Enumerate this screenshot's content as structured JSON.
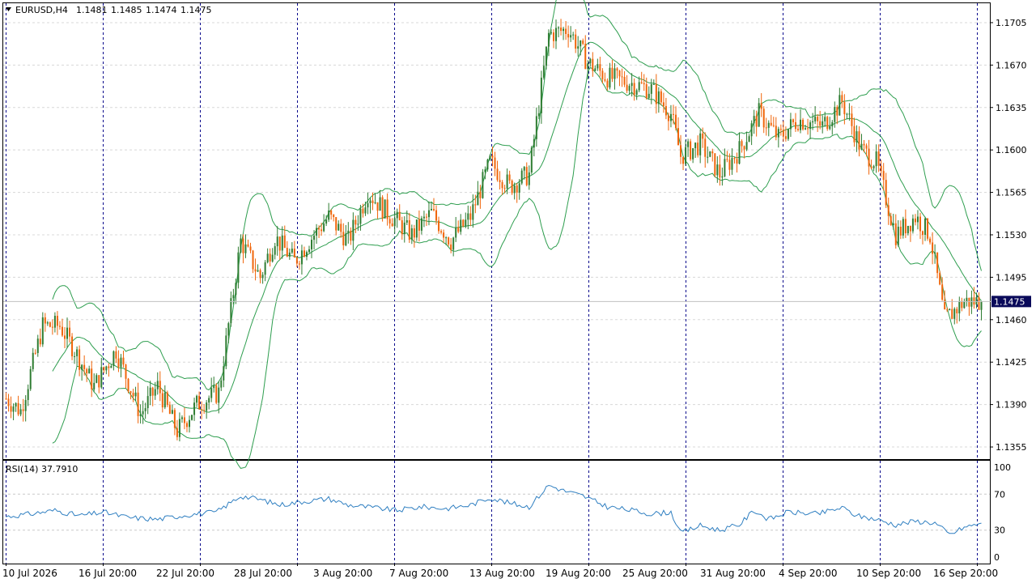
{
  "header": {
    "symbol": "EURUSD,H4",
    "open": "1.1481",
    "high": "1.1485",
    "low": "1.1474",
    "close": "1.1475"
  },
  "price_axis": {
    "ticks": [
      "1.1705",
      "1.1670",
      "1.1635",
      "1.1600",
      "1.1565",
      "1.1530",
      "1.1495",
      "1.1460",
      "1.1425",
      "1.1390",
      "1.1355"
    ],
    "current_price_label": "1.1475"
  },
  "rsi_panel": {
    "label": "RSI(14) 37.7910",
    "ticks": [
      "100",
      "70",
      "30",
      "0"
    ]
  },
  "time_axis": {
    "labels": [
      "10 Jul 2026",
      "16 Jul 20:00",
      "22 Jul 20:00",
      "28 Jul 20:00",
      "3 Aug 20:00",
      "7 Aug 20:00",
      "13 Aug 20:00",
      "19 Aug 20:00",
      "25 Aug 20:00",
      "31 Aug 20:00",
      "4 Sep 20:00",
      "10 Sep 20:00",
      "16 Sep 20:00"
    ]
  },
  "colors": {
    "bull": "#2f7d32",
    "bear": "#f0650a",
    "band": "#2e9e4f",
    "rsi_line": "#2f7fc1",
    "separator": "#00008b",
    "price_tag_bg": "#0a0a5a"
  },
  "chart_data": [
    {
      "type": "candlestick",
      "title": "EURUSD,H4",
      "ylim": [
        1.1345,
        1.1721
      ],
      "current_price": 1.1475,
      "indicators": [
        "Bollinger Bands"
      ],
      "grid": true,
      "anchors": [
        [
          0,
          1.1395
        ],
        [
          6,
          1.1385
        ],
        [
          15,
          1.1455
        ],
        [
          22,
          1.1455
        ],
        [
          28,
          1.1435
        ],
        [
          36,
          1.1405
        ],
        [
          45,
          1.1435
        ],
        [
          55,
          1.1382
        ],
        [
          62,
          1.1405
        ],
        [
          70,
          1.1368
        ],
        [
          78,
          1.139
        ],
        [
          87,
          1.14
        ],
        [
          96,
          1.1525
        ],
        [
          104,
          1.1495
        ],
        [
          110,
          1.1528
        ],
        [
          118,
          1.1508
        ],
        [
          124,
          1.1525
        ],
        [
          132,
          1.1545
        ],
        [
          140,
          1.1525
        ],
        [
          148,
          1.1565
        ],
        [
          156,
          1.1548
        ],
        [
          166,
          1.153
        ],
        [
          174,
          1.1548
        ],
        [
          182,
          1.1525
        ],
        [
          190,
          1.1545
        ],
        [
          198,
          1.159
        ],
        [
          206,
          1.157
        ],
        [
          214,
          1.158
        ],
        [
          222,
          1.1695
        ],
        [
          230,
          1.17
        ],
        [
          238,
          1.1672
        ],
        [
          246,
          1.166
        ],
        [
          256,
          1.1655
        ],
        [
          264,
          1.165
        ],
        [
          272,
          1.163
        ],
        [
          276,
          1.1595
        ],
        [
          284,
          1.1605
        ],
        [
          292,
          1.158
        ],
        [
          300,
          1.16
        ],
        [
          308,
          1.163
        ],
        [
          316,
          1.161
        ],
        [
          324,
          1.1625
        ],
        [
          334,
          1.162
        ],
        [
          342,
          1.164
        ],
        [
          350,
          1.16
        ],
        [
          356,
          1.159
        ],
        [
          364,
          1.153
        ],
        [
          372,
          1.1545
        ],
        [
          378,
          1.153
        ],
        [
          384,
          1.146
        ],
        [
          392,
          1.1475
        ],
        [
          399,
          1.1475
        ]
      ]
    },
    {
      "type": "line",
      "title": "RSI(14) 37.7910",
      "ylim": [
        0,
        100
      ],
      "levels": [
        30,
        70
      ],
      "anchors": [
        [
          0,
          45
        ],
        [
          10,
          48
        ],
        [
          20,
          52
        ],
        [
          30,
          46
        ],
        [
          40,
          50
        ],
        [
          50,
          44
        ],
        [
          62,
          42
        ],
        [
          74,
          47
        ],
        [
          86,
          50
        ],
        [
          96,
          68
        ],
        [
          104,
          64
        ],
        [
          112,
          58
        ],
        [
          122,
          62
        ],
        [
          132,
          65
        ],
        [
          140,
          58
        ],
        [
          150,
          55
        ],
        [
          160,
          52
        ],
        [
          170,
          56
        ],
        [
          180,
          54
        ],
        [
          190,
          58
        ],
        [
          198,
          66
        ],
        [
          206,
          60
        ],
        [
          214,
          56
        ],
        [
          222,
          80
        ],
        [
          228,
          74
        ],
        [
          236,
          68
        ],
        [
          246,
          56
        ],
        [
          256,
          52
        ],
        [
          264,
          48
        ],
        [
          272,
          50
        ],
        [
          276,
          27
        ],
        [
          284,
          35
        ],
        [
          292,
          30
        ],
        [
          300,
          36
        ],
        [
          306,
          52
        ],
        [
          312,
          42
        ],
        [
          320,
          50
        ],
        [
          332,
          48
        ],
        [
          342,
          55
        ],
        [
          348,
          46
        ],
        [
          356,
          42
        ],
        [
          364,
          36
        ],
        [
          372,
          40
        ],
        [
          380,
          38
        ],
        [
          386,
          25
        ],
        [
          392,
          33
        ],
        [
          399,
          37.79
        ]
      ]
    }
  ]
}
